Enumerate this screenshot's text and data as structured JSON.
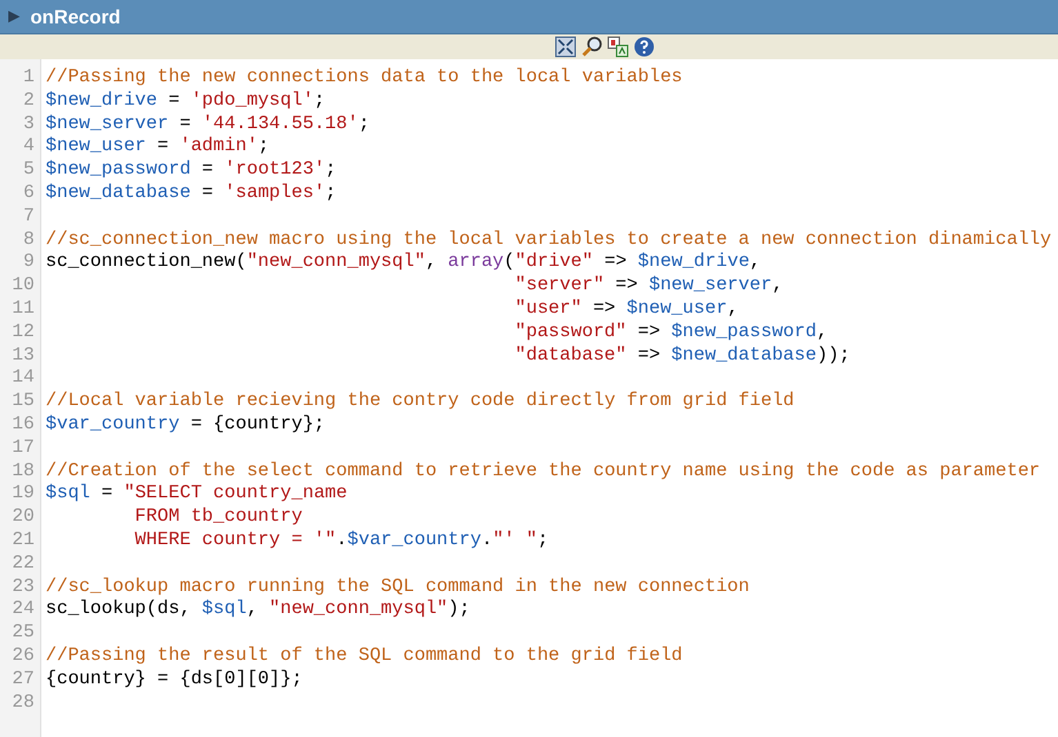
{
  "panel": {
    "title": "onRecord",
    "toggle": "▶",
    "expanded": false
  },
  "editor": {
    "lines": [
      {
        "number": "1",
        "tokens": [
          {
            "kind": "comment",
            "text": "//Passing the new connections data to the local variables"
          }
        ]
      },
      {
        "number": "2",
        "tokens": [
          {
            "kind": "variable",
            "text": "$new_drive"
          },
          {
            "kind": "plain",
            "text": " = "
          },
          {
            "kind": "string",
            "text": "'pdo_mysql'"
          },
          {
            "kind": "plain",
            "text": ";"
          }
        ]
      },
      {
        "number": "3",
        "tokens": [
          {
            "kind": "variable",
            "text": "$new_server"
          },
          {
            "kind": "plain",
            "text": " = "
          },
          {
            "kind": "string",
            "text": "'44.134.55.18'"
          },
          {
            "kind": "plain",
            "text": ";"
          }
        ]
      },
      {
        "number": "4",
        "tokens": [
          {
            "kind": "variable",
            "text": "$new_user"
          },
          {
            "kind": "plain",
            "text": " = "
          },
          {
            "kind": "string",
            "text": "'admin'"
          },
          {
            "kind": "plain",
            "text": ";"
          }
        ]
      },
      {
        "number": "5",
        "tokens": [
          {
            "kind": "variable",
            "text": "$new_password"
          },
          {
            "kind": "plain",
            "text": " = "
          },
          {
            "kind": "string",
            "text": "'root123'"
          },
          {
            "kind": "plain",
            "text": ";"
          }
        ]
      },
      {
        "number": "6",
        "tokens": [
          {
            "kind": "variable",
            "text": "$new_database"
          },
          {
            "kind": "plain",
            "text": " = "
          },
          {
            "kind": "string",
            "text": "'samples'"
          },
          {
            "kind": "plain",
            "text": ";"
          }
        ]
      },
      {
        "number": "7"
      },
      {
        "number": "8",
        "tokens": [
          {
            "kind": "comment",
            "text": "//sc_connection_new macro using the local variables to create a new connection dinamically"
          }
        ]
      },
      {
        "number": "9",
        "tokens": [
          {
            "kind": "plain",
            "text": "sc_connection_new("
          },
          {
            "kind": "string",
            "text": "\"new_conn_mysql\""
          },
          {
            "kind": "plain",
            "text": ", "
          },
          {
            "kind": "keyword",
            "text": "array"
          },
          {
            "kind": "plain",
            "text": "("
          },
          {
            "kind": "string",
            "text": "\"drive\""
          },
          {
            "kind": "plain",
            "text": " => "
          },
          {
            "kind": "variable",
            "text": "$new_drive"
          },
          {
            "kind": "plain",
            "text": ","
          }
        ]
      },
      {
        "number": "10",
        "continuation": true,
        "tokens": [
          {
            "kind": "string",
            "text": "\"server\""
          },
          {
            "kind": "plain",
            "text": " => "
          },
          {
            "kind": "variable",
            "text": "$new_server"
          },
          {
            "kind": "plain",
            "text": ","
          }
        ]
      },
      {
        "number": "11",
        "continuation": true,
        "tokens": [
          {
            "kind": "string",
            "text": "\"user\""
          },
          {
            "kind": "plain",
            "text": " => "
          },
          {
            "kind": "variable",
            "text": "$new_user"
          },
          {
            "kind": "plain",
            "text": ","
          }
        ]
      },
      {
        "number": "12",
        "continuation": true,
        "tokens": [
          {
            "kind": "string",
            "text": "\"password\""
          },
          {
            "kind": "plain",
            "text": " => "
          },
          {
            "kind": "variable",
            "text": "$new_password"
          },
          {
            "kind": "plain",
            "text": ","
          }
        ]
      },
      {
        "number": "13",
        "continuation": true,
        "tokens": [
          {
            "kind": "string",
            "text": "\"database\""
          },
          {
            "kind": "plain",
            "text": " => "
          },
          {
            "kind": "variable",
            "text": "$new_database"
          },
          {
            "kind": "plain",
            "text": "));"
          }
        ]
      },
      {
        "number": "14"
      },
      {
        "number": "15",
        "tokens": [
          {
            "kind": "comment",
            "text": "//Local variable recieving the contry code directly from grid field"
          }
        ]
      },
      {
        "number": "16",
        "tokens": [
          {
            "kind": "variable",
            "text": "$var_country"
          },
          {
            "kind": "plain",
            "text": " = {country};"
          }
        ]
      },
      {
        "number": "17"
      },
      {
        "number": "18",
        "tokens": [
          {
            "kind": "comment",
            "text": "//Creation of the select command to retrieve the country name using the code as parameter"
          }
        ]
      },
      {
        "number": "19",
        "tokens": [
          {
            "kind": "variable",
            "text": "$sql"
          },
          {
            "kind": "plain",
            "text": " = "
          },
          {
            "kind": "string",
            "text": "\"SELECT country_name"
          }
        ]
      },
      {
        "number": "20",
        "tokens": [
          {
            "kind": "string",
            "text": "        FROM tb_country"
          }
        ]
      },
      {
        "number": "21",
        "tokens": [
          {
            "kind": "string",
            "text": "        WHERE country = '\""
          },
          {
            "kind": "plain",
            "text": "."
          },
          {
            "kind": "variable",
            "text": "$var_country"
          },
          {
            "kind": "plain",
            "text": "."
          },
          {
            "kind": "string",
            "text": "\"' \""
          },
          {
            "kind": "plain",
            "text": ";"
          }
        ]
      },
      {
        "number": "22"
      },
      {
        "number": "23",
        "tokens": [
          {
            "kind": "comment",
            "text": "//sc_lookup macro running the SQL command in the new connection"
          }
        ]
      },
      {
        "number": "24",
        "tokens": [
          {
            "kind": "plain",
            "text": "sc_lookup(ds, "
          },
          {
            "kind": "variable",
            "text": "$sql"
          },
          {
            "kind": "plain",
            "text": ", "
          },
          {
            "kind": "string",
            "text": "\"new_conn_mysql\""
          },
          {
            "kind": "plain",
            "text": ");"
          }
        ]
      },
      {
        "number": "25"
      },
      {
        "number": "26",
        "tokens": [
          {
            "kind": "comment",
            "text": "//Passing the result of the SQL command to the grid field"
          }
        ]
      },
      {
        "number": "27",
        "tokens": [
          {
            "kind": "plain",
            "text": "{country} = {ds[0][0]};"
          }
        ]
      },
      {
        "number": "28"
      }
    ]
  }
}
